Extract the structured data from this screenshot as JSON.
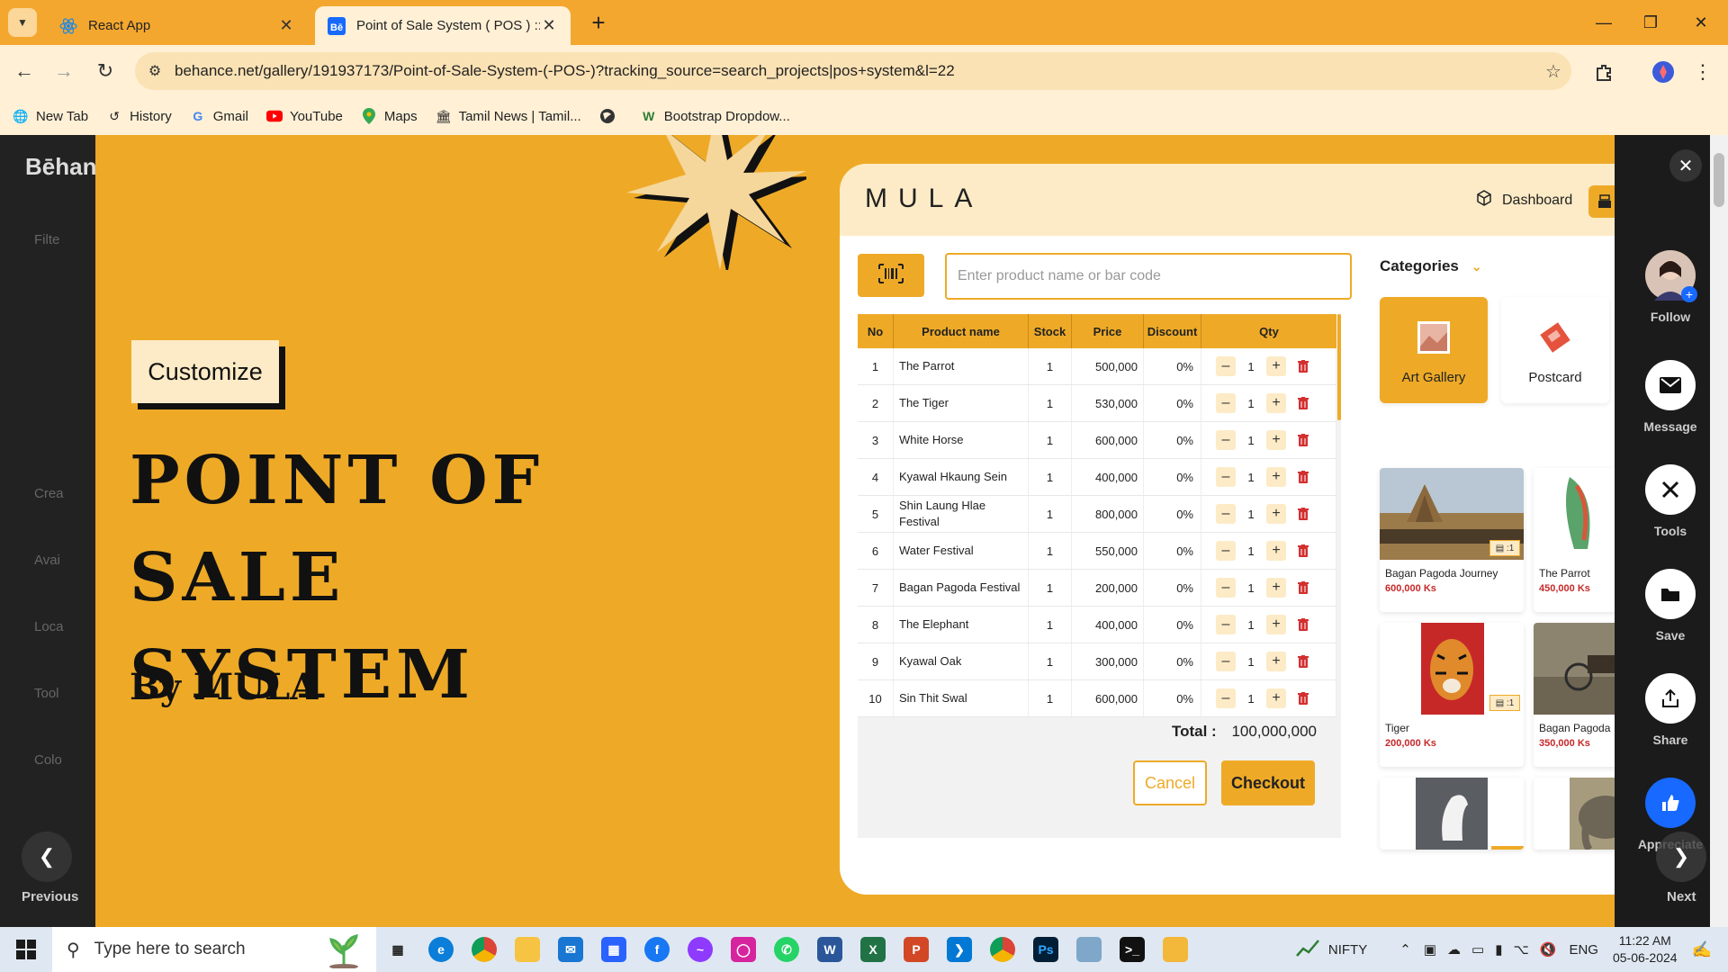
{
  "browser": {
    "tabs": [
      {
        "title": "React App",
        "active": false,
        "icon": "react-icon"
      },
      {
        "title": "Point of Sale System ( POS ) :: Behance",
        "active": true,
        "icon": "behance-icon"
      }
    ],
    "new_tab_symbol": "+",
    "url": "behance.net/gallery/191937173/Point-of-Sale-System-(-POS-)?tracking_source=search_projects|pos+system&l=22",
    "bookmarks": [
      {
        "label": "New Tab",
        "icon": "globe-icon"
      },
      {
        "label": "History",
        "icon": "history-icon"
      },
      {
        "label": "Gmail",
        "icon": "google-icon"
      },
      {
        "label": "YouTube",
        "icon": "youtube-icon"
      },
      {
        "label": "Maps",
        "icon": "maps-icon"
      },
      {
        "label": "Tamil News | Tamil...",
        "icon": "news-icon"
      },
      {
        "label": "",
        "icon": "world-icon"
      },
      {
        "label": "Bootstrap Dropdow...",
        "icon": "w-icon"
      }
    ]
  },
  "behance": {
    "logo": "Bēhance",
    "side_items": [
      "Filte",
      "Crea",
      "Avai",
      "Loca",
      "Tool",
      "Colo"
    ],
    "rail": [
      {
        "label": "Follow",
        "icon": "avatar-icon"
      },
      {
        "label": "Message",
        "icon": "mail-icon"
      },
      {
        "label": "Tools",
        "icon": "tools-icon"
      },
      {
        "label": "Save",
        "icon": "folder-icon"
      },
      {
        "label": "Share",
        "icon": "share-icon"
      },
      {
        "label": "Appreciate",
        "icon": "thumbs-up-icon"
      }
    ],
    "prev_label": "Previous",
    "next_label": "Next"
  },
  "artboard": {
    "customize_label": "Customize",
    "title_line1": "POINT OF SALE",
    "title_line2": "SYSTEM",
    "byline": "By MULA"
  },
  "pos": {
    "logo": "MULA",
    "dashboard_label": "Dashboard",
    "search_placeholder": "Enter product name or bar code",
    "columns": [
      "No",
      "Product name",
      "Stock",
      "Price",
      "Discount",
      "Qty"
    ],
    "rows": [
      {
        "no": "1",
        "name": "The Parrot",
        "stock": "1",
        "price": "500,000",
        "discount": "0%",
        "qty": "1"
      },
      {
        "no": "2",
        "name": "The Tiger",
        "stock": "1",
        "price": "530,000",
        "discount": "0%",
        "qty": "1"
      },
      {
        "no": "3",
        "name": "White Horse",
        "stock": "1",
        "price": "600,000",
        "discount": "0%",
        "qty": "1"
      },
      {
        "no": "4",
        "name": "Kyawal Hkaung Sein",
        "stock": "1",
        "price": "400,000",
        "discount": "0%",
        "qty": "1"
      },
      {
        "no": "5",
        "name": "Shin Laung Hlae Festival",
        "stock": "1",
        "price": "800,000",
        "discount": "0%",
        "qty": "1"
      },
      {
        "no": "6",
        "name": "Water Festival",
        "stock": "1",
        "price": "550,000",
        "discount": "0%",
        "qty": "1"
      },
      {
        "no": "7",
        "name": "Bagan Pagoda Festival",
        "stock": "1",
        "price": "200,000",
        "discount": "0%",
        "qty": "1"
      },
      {
        "no": "8",
        "name": "The Elephant",
        "stock": "1",
        "price": "400,000",
        "discount": "0%",
        "qty": "1"
      },
      {
        "no": "9",
        "name": "Kyawal Oak",
        "stock": "1",
        "price": "300,000",
        "discount": "0%",
        "qty": "1"
      },
      {
        "no": "10",
        "name": "Sin Thit Swal",
        "stock": "1",
        "price": "600,000",
        "discount": "0%",
        "qty": "1"
      }
    ],
    "total_label": "Total :",
    "total_value": "100,000,000",
    "cancel_label": "Cancel",
    "checkout_label": "Checkout",
    "categories_label": "Categories",
    "categories": [
      {
        "label": "Art Gallery",
        "active": true
      },
      {
        "label": "Postcard",
        "active": false
      }
    ],
    "products": [
      {
        "name": "Bagan Pagoda Journey",
        "price": "600,000 Ks",
        "stock": "1"
      },
      {
        "name": "The Parrot",
        "price": "450,000 Ks",
        "stock": ""
      },
      {
        "name": "Tiger",
        "price": "200,000 Ks",
        "stock": "1"
      },
      {
        "name": "Bagan Pagoda",
        "price": "350,000 Ks",
        "stock": ""
      }
    ]
  },
  "taskbar": {
    "search_placeholder": "Type here to search",
    "ticker": "NIFTY",
    "language": "ENG",
    "time": "11:22 AM",
    "date": "05-06-2024"
  },
  "colors": {
    "brand": "#eeaa27",
    "brand_light": "#fcebc6",
    "price_red": "#c62828"
  }
}
